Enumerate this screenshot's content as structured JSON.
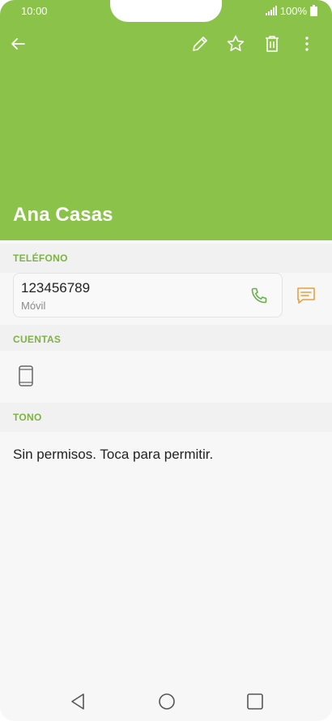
{
  "status_bar": {
    "time": "10:00",
    "battery_percent": "100%"
  },
  "toolbar": {
    "back_icon": "back-arrow-icon",
    "edit_icon": "pencil-icon",
    "favorite_icon": "star-icon",
    "delete_icon": "trash-icon",
    "more_icon": "more-vertical-icon"
  },
  "contact": {
    "name": "Ana Casas"
  },
  "sections": {
    "phone": {
      "title": "TELÉFONO",
      "number": "123456789",
      "type": "Móvil"
    },
    "accounts": {
      "title": "CUENTAS"
    },
    "ringtone": {
      "title": "TONO",
      "value": "Sin permisos. Toca para permitir."
    }
  },
  "colors": {
    "header_bg": "#8bc34a",
    "accent_green": "#7cb342",
    "message_orange": "#e6a23c"
  }
}
